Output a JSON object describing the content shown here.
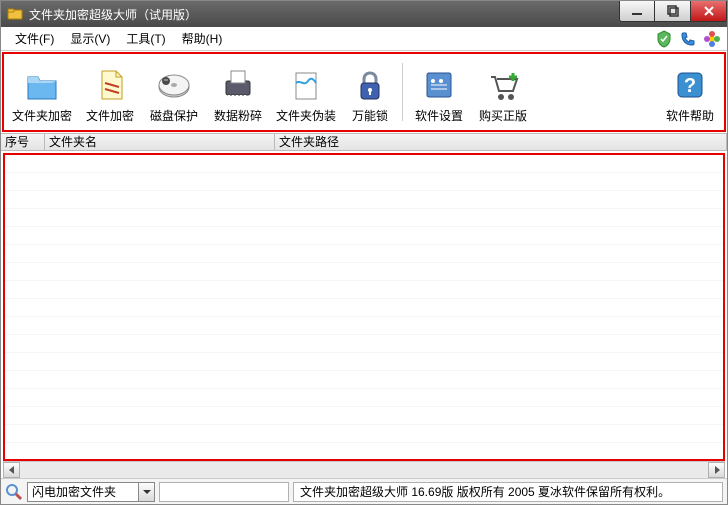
{
  "title": "文件夹加密超级大师（试用版）",
  "menu": {
    "file": "文件(F)",
    "view": "显示(V)",
    "tools": "工具(T)",
    "help": "帮助(H)"
  },
  "toolbar": {
    "folder_encrypt": "文件夹加密",
    "file_encrypt": "文件加密",
    "disk_protect": "磁盘保护",
    "data_shred": "数据粉碎",
    "folder_disguise": "文件夹伪装",
    "master_lock": "万能锁",
    "settings": "软件设置",
    "buy": "购买正版",
    "help": "软件帮助"
  },
  "columns": {
    "seq": "序号",
    "name": "文件夹名",
    "path": "文件夹路径"
  },
  "combo": {
    "value": "闪电加密文件夹"
  },
  "status": "文件夹加密超级大师 16.69版 版权所有 2005 夏冰软件保留所有权利。"
}
